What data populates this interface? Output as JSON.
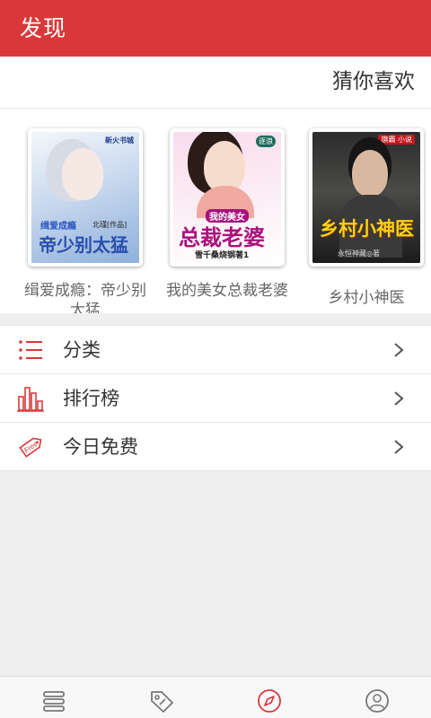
{
  "header": {
    "title": "发现"
  },
  "recommend": {
    "section_title": "猜你喜欢",
    "books": [
      {
        "name": "缉爱成瘾：帝少别太猛",
        "cover_text": {
          "title": "帝少别太猛",
          "tag": "缉爱成瘾",
          "badge": "新火书城",
          "author": "北瑾[作品]"
        }
      },
      {
        "name": "我的美女总裁老婆",
        "cover_text": {
          "title": "总裁老婆",
          "tag": "我的美女",
          "badge": "逐浪",
          "author": "雪千桑烧钢著1"
        }
      },
      {
        "name": "乡村小神医",
        "cover_text": {
          "title": "乡村小神医",
          "badge": "旗霸 小说",
          "author": "永恒神藏◎著"
        }
      }
    ]
  },
  "menu": {
    "items": [
      {
        "label": "分类",
        "icon": "list-icon"
      },
      {
        "label": "排行榜",
        "icon": "bar-chart-icon"
      },
      {
        "label": "今日免费",
        "icon": "free-tag-icon"
      }
    ]
  },
  "bottom_nav": {
    "tabs": [
      {
        "icon": "bookshelf-icon"
      },
      {
        "icon": "tag-icon"
      },
      {
        "icon": "compass-icon",
        "active": true
      },
      {
        "icon": "user-icon"
      }
    ]
  },
  "colors": {
    "brand": "#d9383a",
    "icon_red": "#d9383a",
    "text": "#333333",
    "muted": "#666666"
  }
}
